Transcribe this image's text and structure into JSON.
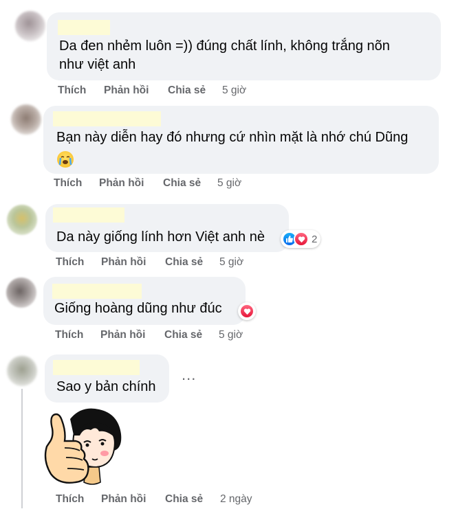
{
  "comments": [
    {
      "text_lines": [
        "Da đen nhẻm luôn =)) đúng chất lính, không trắng nõn",
        "như việt anh"
      ],
      "actions": {
        "like": "Thích",
        "reply": "Phản hồi",
        "share": "Chia sẻ",
        "time": "5 giờ"
      }
    },
    {
      "text_lines": [
        "Bạn này diễn hay đó nhưng cứ nhìn mặt là nhớ chú Dũng"
      ],
      "emoji": "crying-face",
      "actions": {
        "like": "Thích",
        "reply": "Phản hồi",
        "share": "Chia sẻ",
        "time": "5 giờ"
      }
    },
    {
      "text_lines": [
        "Da này giống lính hơn Việt anh nè"
      ],
      "reactions": {
        "types": [
          "like",
          "love"
        ],
        "count": "2"
      },
      "actions": {
        "like": "Thích",
        "reply": "Phản hồi",
        "share": "Chia sẻ",
        "time": "5 giờ"
      }
    },
    {
      "text_lines": [
        "Giống hoàng dũng như đúc"
      ],
      "reactions": {
        "types": [
          "love"
        ]
      },
      "actions": {
        "like": "Thích",
        "reply": "Phản hồi",
        "share": "Chia sẻ",
        "time": "5 giờ"
      }
    },
    {
      "text_lines": [
        "Sao y bản chính"
      ],
      "more": "...",
      "sticker": "thumbs-up-girl-sticker",
      "actions": {
        "like": "Thích",
        "reply": "Phản hồi",
        "share": "Chia sẻ",
        "time": "2 ngày"
      }
    }
  ],
  "colors": {
    "bubble": "#f0f2f5",
    "action_text": "#65676b",
    "love": "#f33e58",
    "like": "#1877f2"
  }
}
